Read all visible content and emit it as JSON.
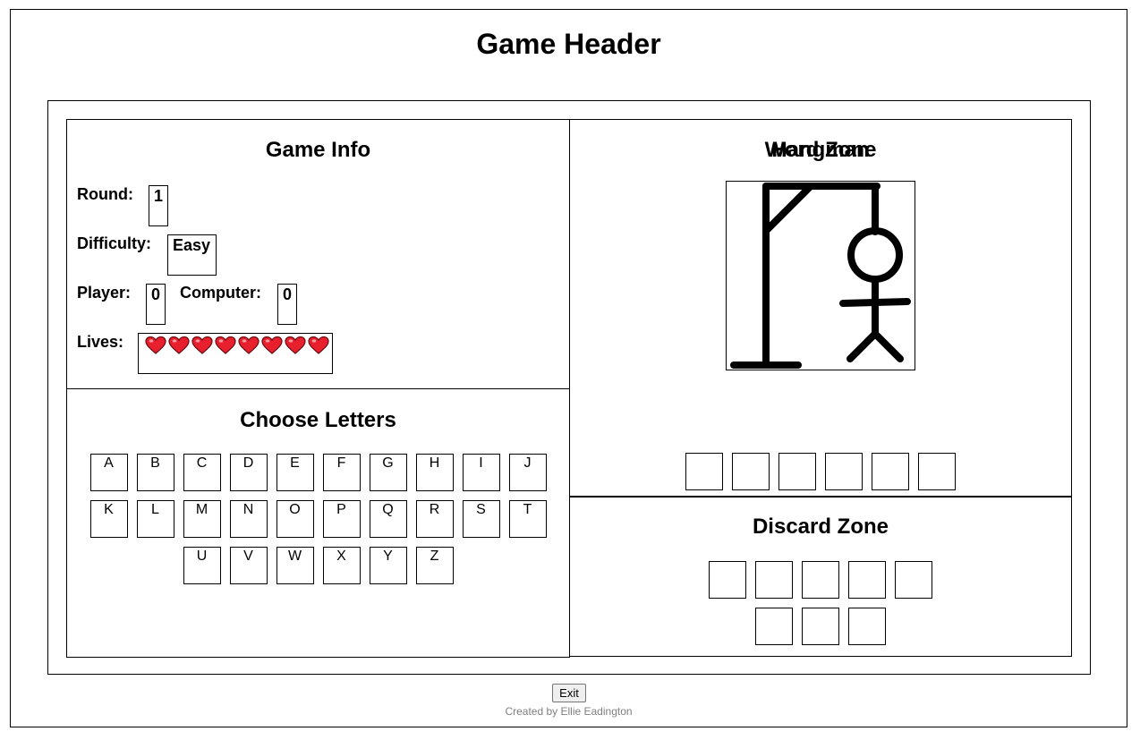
{
  "header": {
    "title": "Game Header"
  },
  "game_info": {
    "title": "Game Info",
    "round_label": "Round:",
    "round_value": "1",
    "difficulty_label": "Difficulty:",
    "difficulty_value": "Easy",
    "player_label": "Player:",
    "player_score": "0",
    "computer_label": "Computer:",
    "computer_score": "0",
    "lives_label": "Lives:",
    "lives_count": 8
  },
  "letters": {
    "title": "Choose Letters",
    "rows": [
      [
        "A",
        "B",
        "C",
        "D",
        "E",
        "F",
        "G",
        "H",
        "I",
        "J"
      ],
      [
        "K",
        "L",
        "M",
        "N",
        "O",
        "P",
        "Q",
        "R",
        "S",
        "T"
      ],
      [
        "U",
        "V",
        "W",
        "X",
        "Y",
        "Z"
      ]
    ]
  },
  "hangman": {
    "title": "Hangman",
    "icon": "hangman-figure-icon"
  },
  "word_zone": {
    "title": "Word Zone",
    "slot_count": 6
  },
  "discard_zone": {
    "title": "Discard Zone",
    "rows": [
      5,
      3
    ]
  },
  "footer": {
    "exit_label": "Exit",
    "credit": "Created by Ellie Eadington"
  },
  "colors": {
    "heart": "#e8202e",
    "heart_outline": "#6a0a10",
    "credit_text": "#808080"
  }
}
